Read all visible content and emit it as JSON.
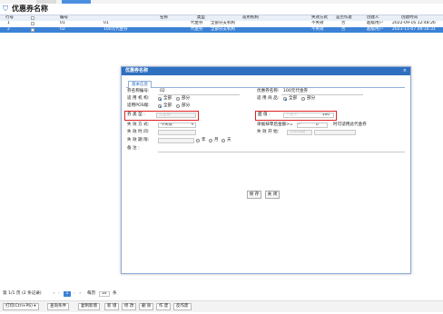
{
  "window": {
    "title": "优惠券名称"
  },
  "grid": {
    "headers": [
      "行号",
      "编号",
      "名称",
      "类型",
      "适用机构",
      "失效方式",
      "是否作废",
      "创建人",
      "创建时间"
    ],
    "rows": [
      {
        "row_no": "1",
        "code": "01",
        "name": "01",
        "type": "代金券",
        "org": "全部分支机构",
        "expire_mode": "不失效",
        "void": "否",
        "creator": "超级用户",
        "created": "2022-09-16 12:48:26"
      },
      {
        "row_no": "2",
        "code": "02",
        "name": "100元代金券",
        "type": "代金券",
        "org": "全部分支机构",
        "expire_mode": "不失效",
        "void": "否",
        "creator": "超级用户",
        "created": "2023-11-07 09:16:31"
      }
    ]
  },
  "modal": {
    "title": "优惠券名称",
    "close": "×",
    "tab": "基本信息",
    "labels": {
      "code": "券名称编号:",
      "name": "优惠券名称:",
      "org": "适 用 机 构:",
      "goods": "适 用 商 品:",
      "pos": "适用POS端:",
      "coupon_type": "券 类 型 :",
      "face_value": "面    值 :",
      "expire_mode": "失 效 方 式:",
      "single_limit": "单据抹零后金额>=",
      "expire_time": "失 效 时 间:",
      "expire_start": "失 效 开 始:",
      "expire_period": "失 效 期 限:",
      "remark": "备    注 :"
    },
    "values": {
      "code": "02",
      "name": "100元代金券",
      "coupon_type_placeholder": "代金券",
      "face_value_placeholder": "人民币",
      "face_value": "100",
      "expire_mode": "不失效",
      "single_limit": "0",
      "single_limit_suffix": "时可适用此代金券",
      "expire_start_placeholder": "入库日期"
    },
    "radios": {
      "all": "全部",
      "part": "部分",
      "year": "年",
      "month": "月",
      "day": "天"
    },
    "buttons": {
      "save": "保 存",
      "close": "关 闭"
    }
  },
  "pager": {
    "summary": "第 1/1 页 (2 条记录)",
    "current_page": "1",
    "page_size_label": "每页",
    "page_size": "34",
    "unit": "条"
  },
  "toolbar": {
    "items": [
      "打印(Ctrl+P6) ▾",
      "查询条件",
      "复制新增",
      "新 增",
      "修 改",
      "删 除",
      "作 废",
      "反作废"
    ]
  },
  "colors": {
    "accent": "#3b82d6",
    "header_blue": "#2f6fbf",
    "highlight_red": "#e02020"
  }
}
